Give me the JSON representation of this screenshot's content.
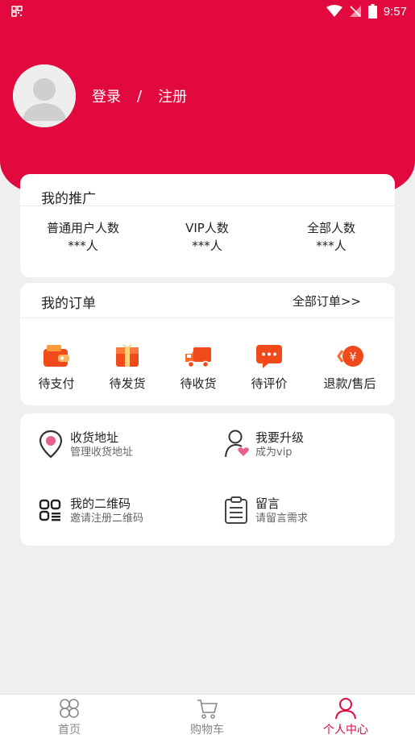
{
  "status_bar": {
    "time": "9:57",
    "icons": [
      "qr-mini-icon",
      "wifi-icon",
      "signal-off-icon",
      "battery-icon"
    ]
  },
  "header": {
    "login_label": "登录",
    "separator": "/",
    "register_label": "注册",
    "accent": "#e1093d"
  },
  "promotion": {
    "title": "我的推广",
    "stats": [
      {
        "label": "普通用户人数",
        "value": "***人"
      },
      {
        "label": "VIP人数",
        "value": "***人"
      },
      {
        "label": "全部人数",
        "value": "***人"
      }
    ]
  },
  "orders": {
    "title": "我的订单",
    "all_link": "全部订单>>",
    "items": [
      {
        "label": "待支付",
        "icon": "wallet-icon"
      },
      {
        "label": "待发货",
        "icon": "gift-box-icon"
      },
      {
        "label": "待收货",
        "icon": "truck-icon"
      },
      {
        "label": "待评价",
        "icon": "chat-bubble-icon"
      },
      {
        "label": "退款/售后",
        "icon": "refund-icon"
      }
    ]
  },
  "tools": [
    {
      "title": "收货地址",
      "subtitle": "管理收货地址",
      "icon": "location-pin-icon"
    },
    {
      "title": "我要升级",
      "subtitle": "成为vip",
      "icon": "user-heart-icon"
    },
    {
      "title": "我的二维码",
      "subtitle": "邀请注册二维码",
      "icon": "qr-code-icon"
    },
    {
      "title": "留言",
      "subtitle": "请留言需求",
      "icon": "clipboard-icon"
    }
  ],
  "bottom_nav": [
    {
      "label": "首页",
      "icon": "home-grid-icon"
    },
    {
      "label": "购物车",
      "icon": "cart-icon"
    },
    {
      "label": "个人中心",
      "icon": "person-icon",
      "active": true
    }
  ],
  "colors": {
    "accent": "#e1093d",
    "order_icon": "#f04a1a",
    "inactive_nav": "#888888"
  }
}
